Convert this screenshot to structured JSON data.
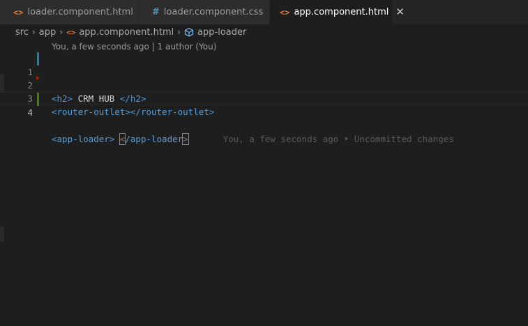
{
  "tabs": [
    {
      "label": "loader.component.html",
      "icon": "html-file-icon",
      "icon_glyph": "<>"
    },
    {
      "label": "loader.component.css",
      "icon": "css-file-icon",
      "icon_glyph": "#"
    },
    {
      "label": "app.component.html",
      "icon": "html-file-icon",
      "icon_glyph": "<>",
      "active": true,
      "close_glyph": "✕"
    }
  ],
  "breadcrumb": {
    "items": [
      "src",
      "app",
      "app.component.html",
      "app-loader"
    ],
    "separator": "›"
  },
  "editor": {
    "codelens": "You, a few seconds ago | 1 author (You)",
    "lines": [
      {
        "number": "1",
        "open_tag": "<h2>",
        "text": " CRM HUB ",
        "close_tag": "</h2>"
      },
      {
        "number": "2"
      },
      {
        "number": "3",
        "open_tag": "<router-outlet>",
        "close_tag": "</router-outlet>"
      },
      {
        "number": "4",
        "open_tag": "<app-loader>",
        "text": " ",
        "close_lt": "<",
        "close_rest": "/app-loader",
        "close_gt": ">",
        "blame": "You, a few seconds ago • Uncommitted changes"
      }
    ]
  },
  "colors": {
    "background": "#1e1e1e",
    "tag": "#569cd6",
    "html_icon": "#e37933",
    "css_icon": "#519aba",
    "gutter_modified": "#1b81a8",
    "gutter_added": "#487e02"
  }
}
